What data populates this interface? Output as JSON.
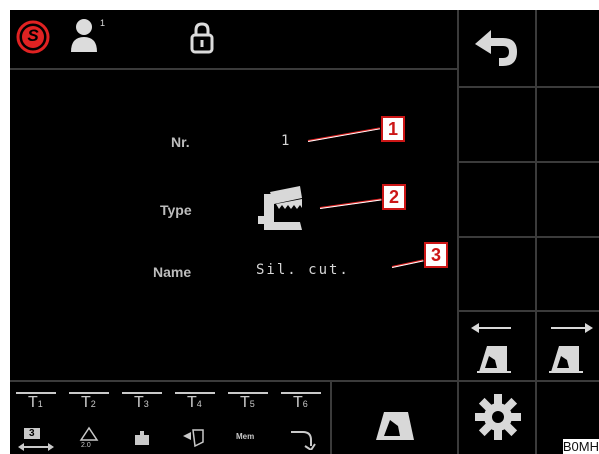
{
  "header": {
    "logo_letter": "S",
    "user_level": "1"
  },
  "fields": [
    {
      "label": "Nr.",
      "value": "1"
    },
    {
      "label": "Type",
      "value": ""
    },
    {
      "label": "Name",
      "value": "Sil. cut."
    }
  ],
  "callouts": [
    "1",
    "2",
    "3"
  ],
  "tool_buttons": [
    {
      "label": "T",
      "num": "1",
      "sub": "3"
    },
    {
      "label": "T",
      "num": "2",
      "sub": "2.0"
    },
    {
      "label": "T",
      "num": "3",
      "sub": ""
    },
    {
      "label": "T",
      "num": "4",
      "sub": ""
    },
    {
      "label": "T",
      "num": "5",
      "sub": "Mem"
    },
    {
      "label": "T",
      "num": "6",
      "sub": ""
    }
  ],
  "figure_code": "B0MH",
  "colors": {
    "background": "#000000",
    "accent": "#e02222",
    "grid": "#3b3b3b"
  }
}
